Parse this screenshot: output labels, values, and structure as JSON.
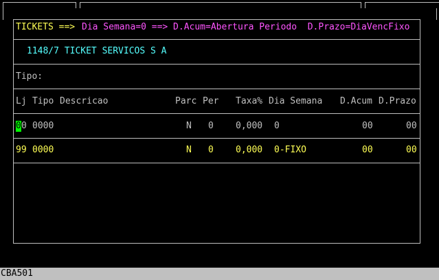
{
  "header": {
    "tickets_label": "TICKETS ==>",
    "legend": "Dia Semana=0 ==> D.Acum=Abertura Periodo  D.Prazo=DiaVencFixo"
  },
  "client": {
    "code_name": "1148/7 TICKET SERVICOS S A"
  },
  "filter": {
    "tipo_label": "Tipo:"
  },
  "table": {
    "columns": {
      "lj": "Lj",
      "tipo": "Tipo",
      "descricao": "Descricao",
      "parc": "Parc",
      "per": "Per",
      "taxa": "Taxa%",
      "dia_semana": "Dia Semana",
      "dacum": "D.Acum",
      "dprazo": "D.Prazo"
    },
    "rows": [
      {
        "lj_cursor": "0",
        "lj_rest": "0",
        "tipo": "0000",
        "parc": "N",
        "per": "0",
        "taxa": "0,000",
        "dia_semana": "0",
        "dacum": "00",
        "dprazo": "00"
      },
      {
        "lj": "99",
        "tipo": "0000",
        "parc": "N",
        "per": "0",
        "taxa": "0,000",
        "dia_semana": "0-FIXO",
        "dacum": "00",
        "dprazo": "00"
      }
    ]
  },
  "status_bar": {
    "program": "CBA501"
  },
  "colors": {
    "frame": "#c0c0c0",
    "highlight": "#ffff55",
    "legend": "#ff55ff",
    "client": "#55ffff",
    "cursor": "#00ff00"
  }
}
